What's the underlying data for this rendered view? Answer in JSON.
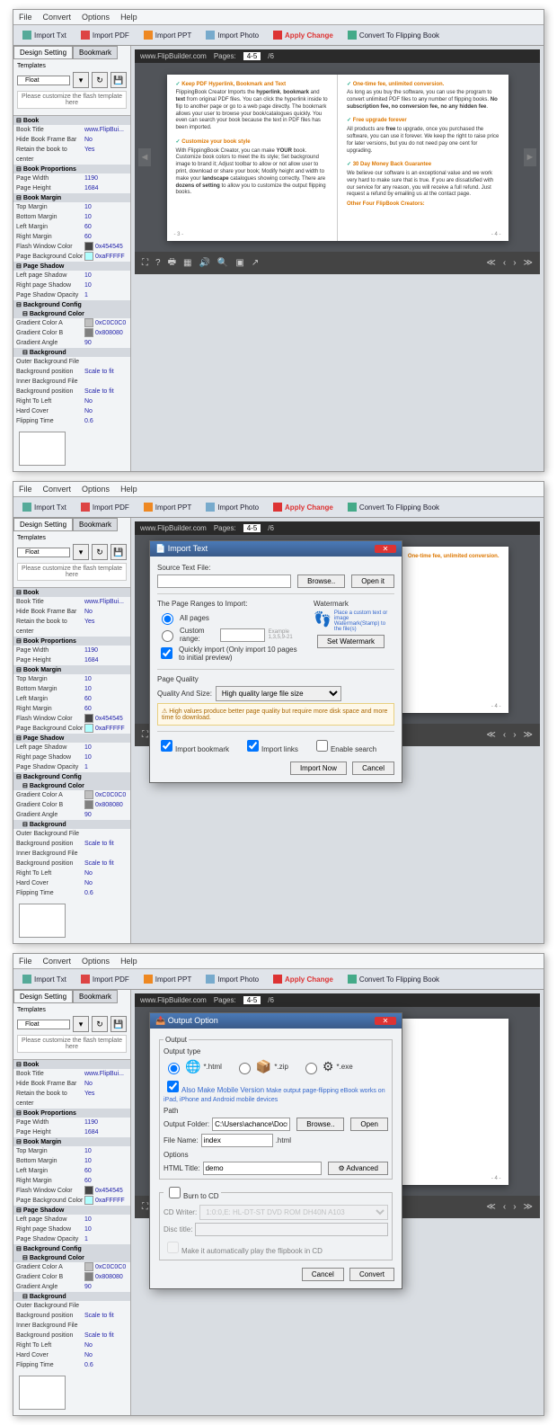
{
  "menu": {
    "file": "File",
    "convert": "Convert",
    "options": "Options",
    "help": "Help"
  },
  "toolbar": {
    "importTxt": "Import Txt",
    "importPdf": "Import PDF",
    "importPpt": "Import PPT",
    "importPhoto": "Import Photo",
    "applyChange": "Apply Change",
    "convertBook": "Convert To Flipping Book"
  },
  "tabs": {
    "design": "Design Setting",
    "bookmark": "Bookmark"
  },
  "tpl": {
    "label": "Templates",
    "value": "Float",
    "note": "Please customize the flash template here"
  },
  "props": {
    "book": "Book",
    "bookTitle": {
      "k": "Book Title",
      "v": "www.FlipBui..."
    },
    "hideFrame": {
      "k": "Hide Book Frame Bar",
      "v": "No"
    },
    "retain": {
      "k": "Retain the book to center",
      "v": "Yes"
    },
    "bookProp": "Book Proportions",
    "pageW": {
      "k": "Page Width",
      "v": "1190"
    },
    "pageH": {
      "k": "Page Height",
      "v": "1684"
    },
    "bookMarg": "Book Margin",
    "topM": {
      "k": "Top Margin",
      "v": "10"
    },
    "botM": {
      "k": "Bottom Margin",
      "v": "10"
    },
    "leftM": {
      "k": "Left Margin",
      "v": "60"
    },
    "rightM": {
      "k": "Right Margin",
      "v": "60"
    },
    "flashColor": {
      "k": "Flash Window Color",
      "v": "0x454545"
    },
    "pageBg": {
      "k": "Page Background Color",
      "v": "0xaFFFFF"
    },
    "pageShadowH": "Page Shadow",
    "lps": {
      "k": "Left page Shadow",
      "v": "10"
    },
    "rps": {
      "k": "Right page Shadow",
      "v": "10"
    },
    "pso": {
      "k": "Page Shadow Opacity",
      "v": "1"
    },
    "bgCfg": "Background Config",
    "bgColorH": "Background Color",
    "gca": {
      "k": "Gradient Color A",
      "v": "0xC0C0C0"
    },
    "gcb": {
      "k": "Gradient Color B",
      "v": "0x808080"
    },
    "gang": {
      "k": "Gradient Angle",
      "v": "90"
    },
    "bgH": "Background",
    "obf": {
      "k": "Outer Background File",
      "v": ""
    },
    "bgp": {
      "k": "Background position",
      "v": "Scale to fit"
    },
    "ibf": {
      "k": "Inner Background File",
      "v": ""
    },
    "bgp2": {
      "k": "Background position",
      "v": "Scale to fit"
    },
    "rtl": {
      "k": "Right To Left",
      "v": "No"
    },
    "hc": {
      "k": "Hard Cover",
      "v": "No"
    },
    "ft": {
      "k": "Flipping Time",
      "v": "0.6"
    }
  },
  "viewer": {
    "site": "www.FlipBuilder.com",
    "pagesLbl": "Pages:",
    "cur": "4-5",
    "total": "/6"
  },
  "leftPage": {
    "h1": "Keep PDF Hyperlink, Bookmark and Text",
    "p1a": "FlippingBook Creator Imports the ",
    "p1b": "hyperlink",
    "p1c": ", ",
    "p1d": "bookmark",
    "p1e": " and ",
    "p1f": "text",
    "p1g": " from original PDF files. You can click the hyperlink inside to flip to another page or go to a web page directly. The bookmark allows your user to browse your book/catalogues quickly. You even can search your book because the text in PDF files has been imported.",
    "h2": "Customize your book style",
    "p2a": "With FlippingBook Creator, you can make ",
    "p2b": "YOUR",
    "p2c": " book. Customize book colors to meet the its style; Set background image to brand it; Adjust toolbar to allow or not allow user to print, download or share your book; Modify height and width to make your ",
    "p2d": "landscape",
    "p2e": " catalogues showing correctly. There are ",
    "p2f": "dozens of setting",
    "p2g": " to allow you to customize the output flipping books.",
    "num": "- 3 -"
  },
  "rightPage": {
    "h1": "One-time fee, unlimited conversion.",
    "p1a": "As long as you buy the software, you can use the program to convert unlimited PDF files to any number of flipping books. ",
    "p1b": "No subscription fee, no conversion fee, no any hidden fee",
    "h2": "Free upgrade forever",
    "p2a": "All products are ",
    "p2b": "free",
    "p2c": " to upgrade, once you purchased the software, you can use it forever. We keep the right to raise price for later versions, but you do not need pay one cent for upgrading.",
    "h3": "30 Day Money Back Guarantee",
    "p3": "We believe our software is an exceptional value and we work very hard to make sure that is true. If you are dissatisfied with our service for any reason, you will receive a full refund. Just request a refund by emailing us at the contact page.",
    "other": "Other Four FlipBook Creators:",
    "num": "- 4 -"
  },
  "importDlg": {
    "title": "Import Text",
    "srcLbl": "Source Text File:",
    "browse": "Browse..",
    "open": "Open it",
    "rangeLbl": "The Page Ranges to Import:",
    "all": "All pages",
    "custom": "Custom range:",
    "ex": "Example 1,3,5,9-21",
    "quick": "Quickly import (Only import 10 pages to  initial  preview)",
    "wm": "Watermark",
    "wmTxt": "Place a custom text or image Watermark(Stamp) to the file(s)",
    "setWm": "Set Watermark",
    "pq": "Page Quality",
    "qs": "Quality And Size:",
    "qv": "High quality large file size",
    "warn": "High values produce better page quality but require more disk space and more time to download.",
    "ib": "Import bookmark",
    "il": "Import links",
    "es": "Enable search",
    "now": "Import Now",
    "cancel": "Cancel"
  },
  "outputDlg": {
    "title": "Output Option",
    "out": "Output",
    "type": "Output type",
    "html": "*.html",
    "zip": "*.zip",
    "exe": "*.exe",
    "mobile": "Also Make Mobile Version",
    "mobileTxt": "Make output page-flipping eBook works on iPad, iPhone and Android mobile devices",
    "path": "Path",
    "of": "Output Folder:",
    "ofv": "C:\\Users\\achance\\Documents",
    "browse": "Browse..",
    "open": "Open",
    "fn": "File Name:",
    "fnv": "index",
    "ext": ".html",
    "opt": "Options",
    "ht": "HTML Title:",
    "htv": "demo",
    "adv": "Advanced",
    "burn": "Burn to CD",
    "cdw": "CD Writer:",
    "cdv": "1:0:0,E: HL-DT-ST DVD ROM DH40N  A103",
    "dt": "Disc title:",
    "auto": "Make it automatically play the flipbook in CD",
    "cancel": "Cancel",
    "convert": "Convert"
  }
}
